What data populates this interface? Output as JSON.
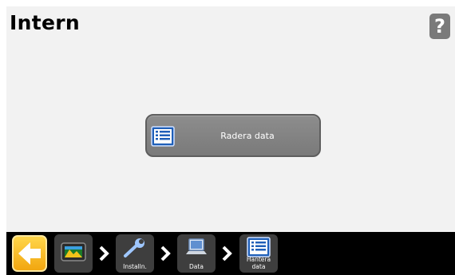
{
  "header": {
    "title": "Intern",
    "help_label": "?"
  },
  "main": {
    "button_label": "Radera data",
    "button_icon": "list-icon"
  },
  "navbar": {
    "back_icon": "back-arrow-icon",
    "breadcrumbs": [
      {
        "label": "",
        "icon": "display-icon"
      },
      {
        "label": "Installn.",
        "icon": "wrench-icon"
      },
      {
        "label": "Data",
        "icon": "laptop-icon"
      },
      {
        "label": "Hantera data",
        "icon": "list-icon"
      }
    ]
  },
  "colors": {
    "back_button": "#f5b21a",
    "crumb_bg": "#3e3e3e",
    "list_icon_blue": "#1f5fb8"
  }
}
